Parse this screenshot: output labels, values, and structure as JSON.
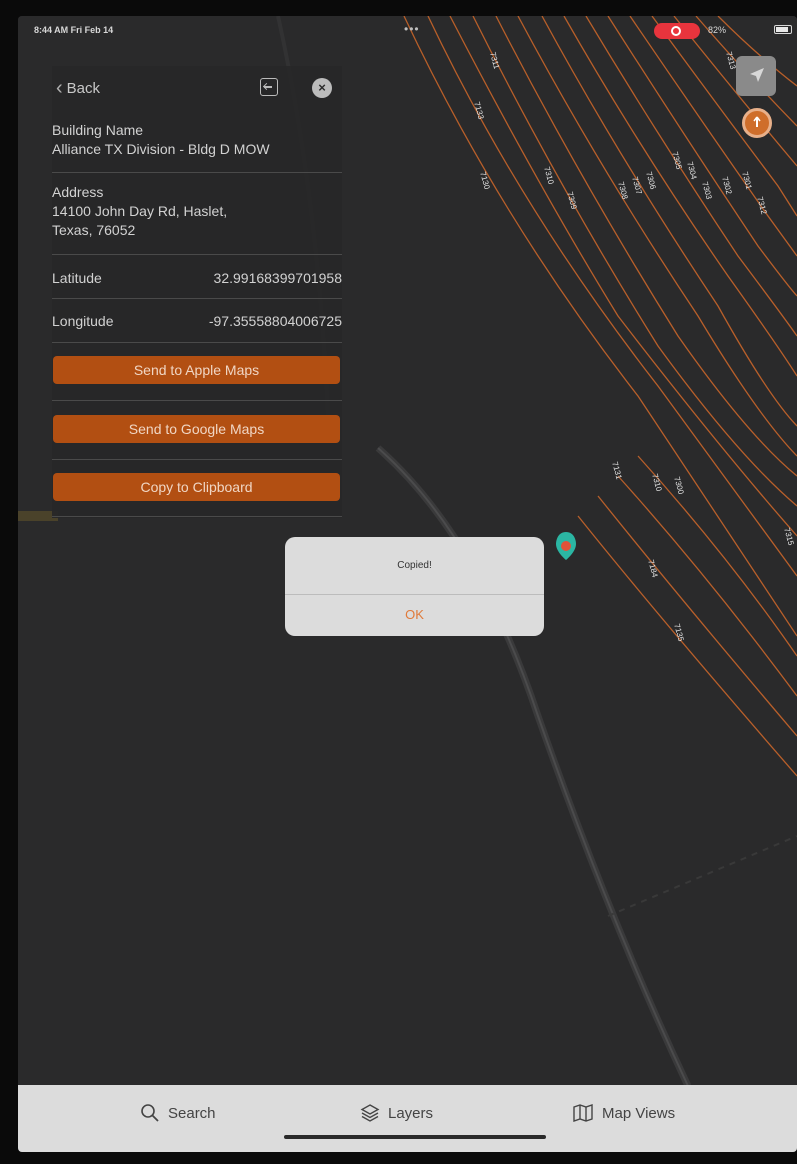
{
  "status_bar": {
    "time": "8:44 AM  Fri Feb 14",
    "dots": "•••",
    "battery": "82%"
  },
  "panel": {
    "back_label": "Back",
    "building_name_label": "Building Name",
    "building_name_value": "Alliance TX Division - Bldg D MOW",
    "address_label": "Address",
    "address_line1": "14100 John Day Rd, Haslet,",
    "address_line2": "Texas, 76052",
    "latitude_label": "Latitude",
    "latitude_value": "32.99168399701958",
    "longitude_label": "Longitude",
    "longitude_value": "-97.35558804006725",
    "buttons": {
      "apple_maps": "Send to Apple Maps",
      "google_maps": "Send to Google Maps",
      "clipboard": "Copy to Clipboard"
    }
  },
  "alert": {
    "message": "Copied!",
    "ok_label": "OK"
  },
  "tabbar": {
    "search": "Search",
    "layers": "Layers",
    "map_views": "Map Views"
  },
  "colors": {
    "accent_orange": "#b24f12",
    "parcel_line": "#c8652a",
    "map_background": "#2a2a2b",
    "marker_teal": "#2bb6a3"
  },
  "map": {
    "parcel_labels": [
      "7311",
      "7133",
      "7130",
      "7310",
      "7309",
      "7308",
      "7307",
      "7306",
      "7305",
      "7304",
      "7303",
      "7302",
      "7301",
      "7313",
      "7312",
      "7131",
      "7310",
      "7300",
      "7184",
      "7135",
      "7315"
    ]
  }
}
